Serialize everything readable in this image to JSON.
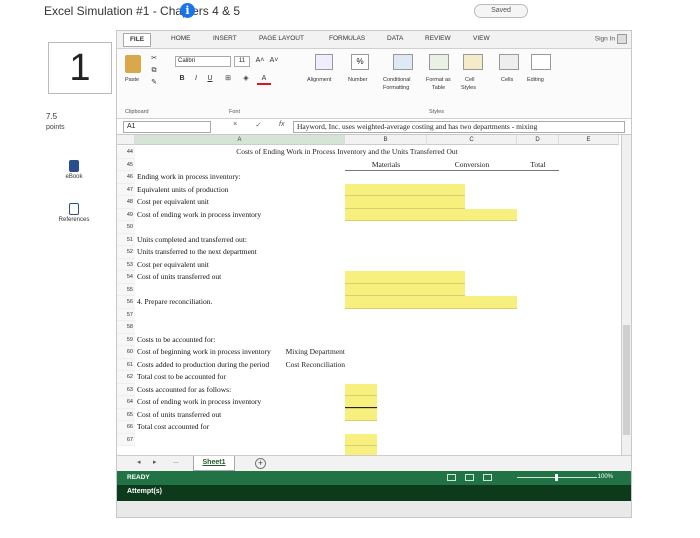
{
  "page": {
    "title": "Excel Simulation #1 - Chapters 4 & 5",
    "info_glyph": "i",
    "saved_label": "Saved"
  },
  "question": {
    "number": "1",
    "points_value": "7.5",
    "points_label": "points"
  },
  "side_tools": {
    "ebook_label": "eBook",
    "references_label": "References"
  },
  "ribbon": {
    "tabs": [
      "FILE",
      "HOME",
      "INSERT",
      "PAGE LAYOUT",
      "FORMULAS",
      "DATA",
      "REVIEW",
      "VIEW"
    ],
    "sign_in": "Sign In",
    "paste_label": "Paste",
    "font_name": "Calibri",
    "font_size": "11",
    "bold": "B",
    "italic": "I",
    "underline": "U",
    "grow_font": "A˄",
    "shrink_font": "A˅",
    "font_color": "A",
    "alignment_label": "Alignment",
    "number_label": "Number",
    "number_glyph": "%",
    "conditional_label": "Conditional",
    "formatting_label": "Formatting",
    "format_as_label": "Format as",
    "table_label": "Table",
    "cell_label": "Cell",
    "styles_label_short": "Styles",
    "cells_label": "Cells",
    "editing_label": "Editing",
    "group_clipboard": "Clipboard",
    "group_font": "Font",
    "group_styles": "Styles"
  },
  "formula_bar": {
    "name_box": "A1",
    "fx": "fx",
    "cancel": "×",
    "enter": "✓",
    "formula": "Hayword, Inc. uses weighted-average costing and has two departments - mixing"
  },
  "grid": {
    "columns": [
      "A",
      "B",
      "C",
      "D",
      "E"
    ],
    "rows": [
      {
        "num": "44",
        "text": ""
      },
      {
        "num": "45",
        "text": ""
      },
      {
        "num": "46",
        "text": "Ending work in process inventory:"
      },
      {
        "num": "47",
        "text": "   Equivalent units of production"
      },
      {
        "num": "48",
        "text": "   Cost per equivalent unit"
      },
      {
        "num": "49",
        "text": "   Cost of ending work in process inventory"
      },
      {
        "num": "50",
        "text": ""
      },
      {
        "num": "51",
        "text": "Units completed and transferred out:"
      },
      {
        "num": "52",
        "text": "   Units transferred to the next department"
      },
      {
        "num": "53",
        "text": "   Cost per equivalent unit"
      },
      {
        "num": "54",
        "text": "   Cost of units transferred out"
      },
      {
        "num": "55",
        "text": ""
      },
      {
        "num": "56",
        "text": "4. Prepare reconciliation."
      },
      {
        "num": "57",
        "text": ""
      },
      {
        "num": "58",
        "text": ""
      },
      {
        "num": "59",
        "text": "Costs to be accounted for:"
      },
      {
        "num": "60",
        "text": "   Cost of beginning work in process inventory"
      },
      {
        "num": "61",
        "text": "   Costs added to production during the period"
      },
      {
        "num": "62",
        "text": "   Total cost to be accounted for"
      },
      {
        "num": "63",
        "text": "Costs accounted for as follows:"
      },
      {
        "num": "64",
        "text": "   Cost of ending work in process inventory"
      },
      {
        "num": "65",
        "text": "   Cost of units transferred out"
      },
      {
        "num": "66",
        "text": "   Total cost accounted for"
      },
      {
        "num": "67",
        "text": ""
      }
    ],
    "heading_costs": "Costs of Ending Work in Process Inventory and the Units Transferred Out",
    "col_materials": "Materials",
    "col_conversion": "Conversion",
    "col_total": "Total",
    "mixing_dept": "Mixing Department",
    "cost_recon": "Cost Reconciliation"
  },
  "sheets": {
    "nav_prev": "◂",
    "nav_next": "▸",
    "ellipsis": "...",
    "active": "Sheet1",
    "add": "+"
  },
  "status": {
    "ready": "READY",
    "zoom": "100%"
  },
  "attempts": {
    "label": "Attempt(s)"
  },
  "colors": {
    "excel_green": "#217346",
    "input_yellow": "#f7ef7e",
    "attempts_bar": "#0e3a1c"
  }
}
